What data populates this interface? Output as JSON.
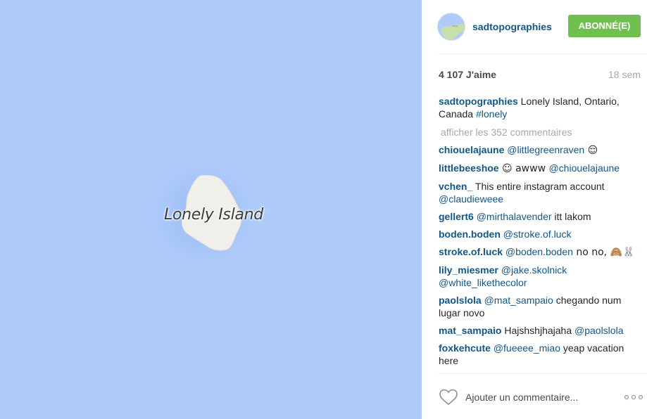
{
  "map": {
    "label": "Lonely Island",
    "water_color": "#aecbfa",
    "land_color": "#f1efe9"
  },
  "post": {
    "username": "sadtopographies",
    "follow_label": "ABONNÉ(E)",
    "likes": "4 107 J'aime",
    "time": "18 sem"
  },
  "caption": {
    "user": "sadtopographies",
    "text": " Lonely Island, Ontario, Canada ",
    "hashtag": "#lonely"
  },
  "load_more": "afficher les 352 commentaires",
  "comments": [
    {
      "user": "chiouelajaune",
      "mention": "@littlegreenraven",
      "text": " 😌",
      "mention2": ""
    },
    {
      "user": "littlebeeshoe",
      "mention": "",
      "text": " ☺ awww ",
      "mention2": "@chiouelajaune"
    },
    {
      "user": "vchen_",
      "mention": "",
      "text": " This entire instagram account ",
      "mention2": "@claudieweee"
    },
    {
      "user": "gellert6",
      "mention": "@mirthalavender",
      "text": " itt lakom",
      "mention2": ""
    },
    {
      "user": "boden.boden",
      "mention": "@stroke.of.luck",
      "text": "",
      "mention2": ""
    },
    {
      "user": "stroke.of.luck",
      "mention": "@boden.boden",
      "text": " no no, 🙈🐰",
      "mention2": ""
    },
    {
      "user": "lily_miesmer",
      "mention": "@jake.skolnick",
      "text": " ",
      "mention2": "@white_likethecolor"
    },
    {
      "user": "paolslola",
      "mention": "@mat_sampaio",
      "text": " chegando num lugar novo",
      "mention2": ""
    },
    {
      "user": "mat_sampaio",
      "mention": "",
      "text": " Hajshshjhajaha ",
      "mention2": "@paolslola"
    },
    {
      "user": "foxkehcute",
      "mention": "@fueeee_miao",
      "text": " yeap vacation here",
      "mention2": ""
    }
  ],
  "footer": {
    "input_placeholder": "Ajouter un commentaire...",
    "more_label": "more-options",
    "heart_icon": "heart-outline-icon"
  },
  "colors": {
    "accent": "#125688",
    "follow_button": "#70c050"
  }
}
